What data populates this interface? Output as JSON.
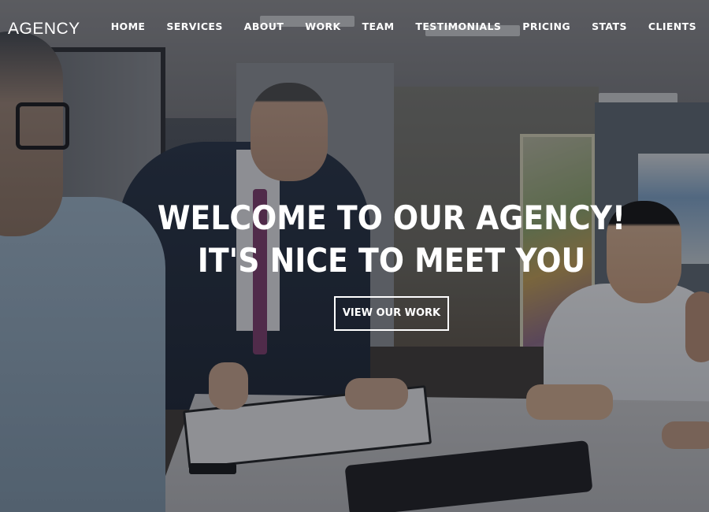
{
  "brand": {
    "name": "AGENCY"
  },
  "nav": {
    "items": [
      {
        "label": "HOME"
      },
      {
        "label": "SERVICES"
      },
      {
        "label": "ABOUT"
      },
      {
        "label": "WORK"
      },
      {
        "label": "TEAM"
      },
      {
        "label": "TESTIMONIALS"
      },
      {
        "label": "PRICING"
      },
      {
        "label": "STATS"
      },
      {
        "label": "CLIENTS"
      }
    ]
  },
  "hero": {
    "title_line1": "WELCOME TO OUR AGENCY!",
    "title_line2": "IT'S NICE TO MEET YOU",
    "button_label": "VIEW OUR WORK"
  }
}
